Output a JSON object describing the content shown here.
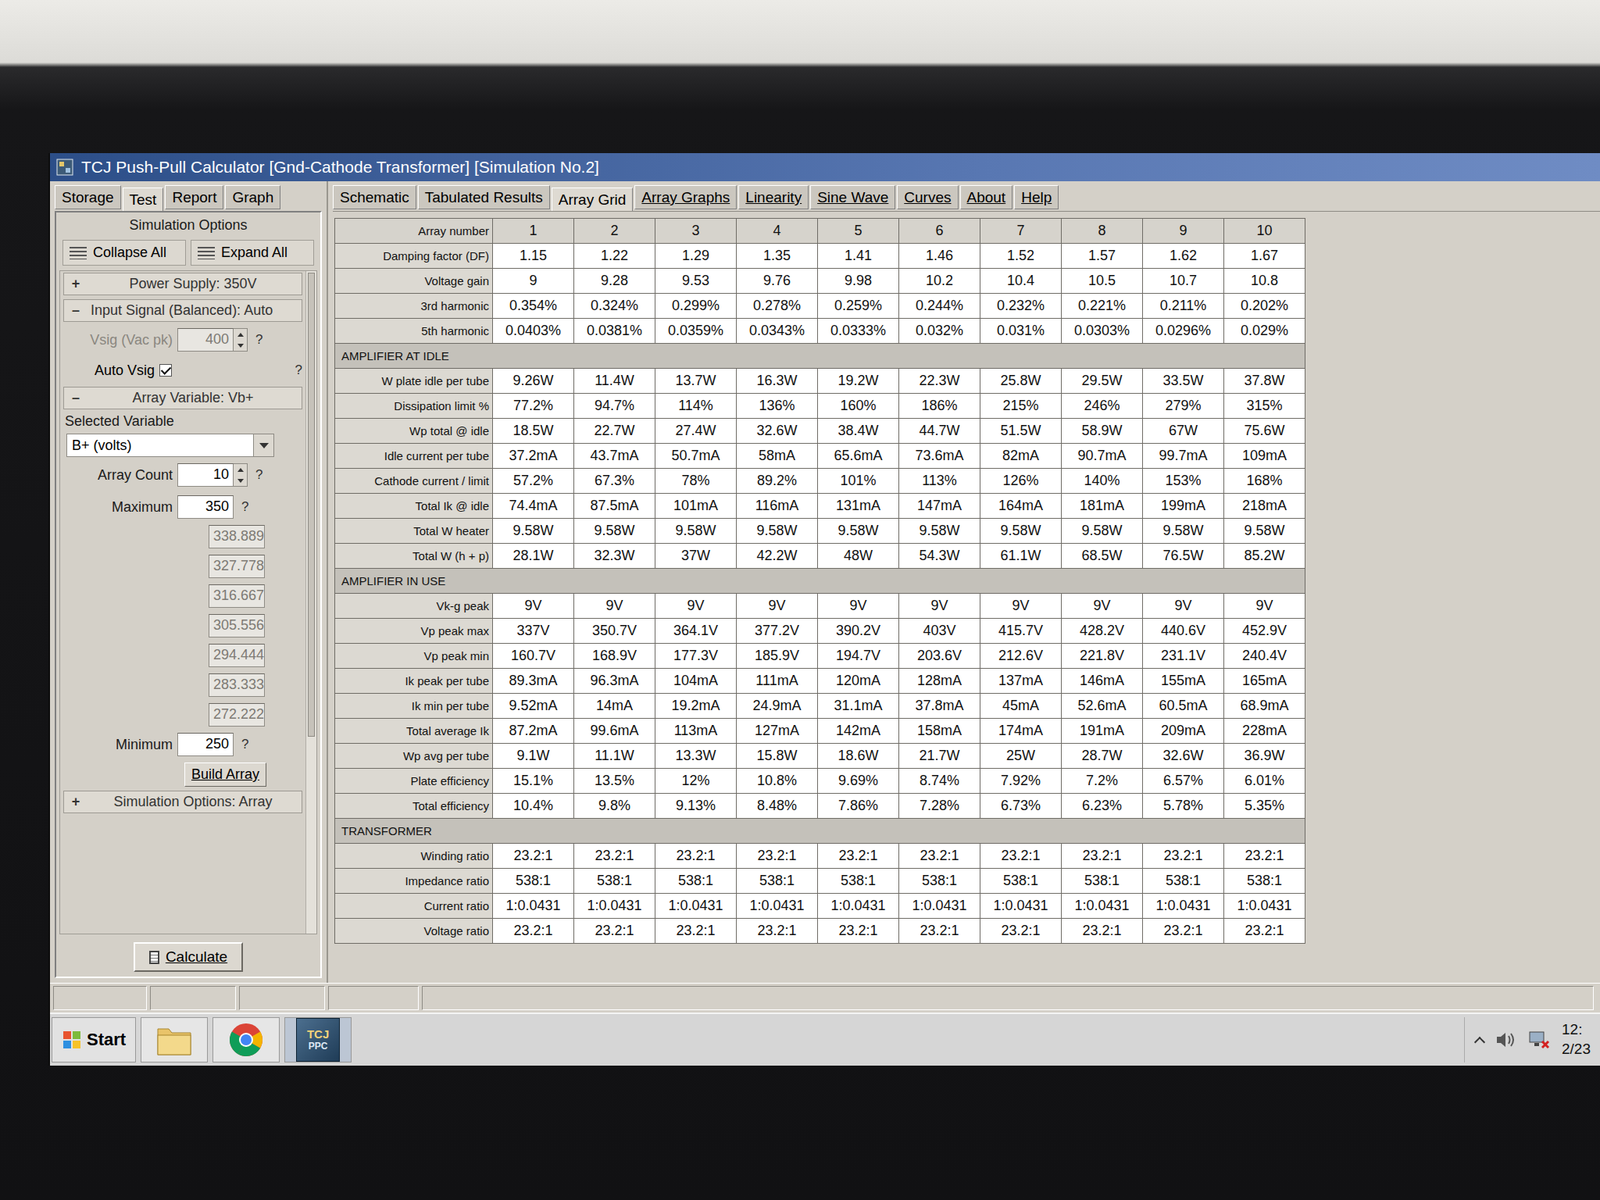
{
  "window": {
    "title": "TCJ Push-Pull Calculator [Gnd-Cathode Transformer] [Simulation No.2]"
  },
  "left_tabs": [
    {
      "label": "Storage",
      "selected": false
    },
    {
      "label": "Test",
      "selected": true
    },
    {
      "label": "Report",
      "selected": false
    },
    {
      "label": "Graph",
      "selected": false
    }
  ],
  "main_tabs": [
    {
      "label": "Schematic",
      "selected": false
    },
    {
      "label": "Tabulated Results",
      "selected": false
    },
    {
      "label": "Array Grid",
      "selected": true
    },
    {
      "label": "Array Graphs",
      "selected": false
    },
    {
      "label": "Linearity",
      "selected": false
    },
    {
      "label": "Sine Wave",
      "selected": false
    },
    {
      "label": "Curves",
      "selected": false
    },
    {
      "label": "About",
      "selected": false
    },
    {
      "label": "Help",
      "selected": false
    }
  ],
  "sidebar": {
    "header": "Simulation Options",
    "collapse_all": "Collapse All",
    "expand_all": "Expand All",
    "power_supply": {
      "toggle": "+",
      "label": "Power Supply: 350V",
      "expanded": false
    },
    "input_signal": {
      "toggle": "–",
      "label": "Input Signal (Balanced): Auto",
      "expanded": true
    },
    "vsig": {
      "label": "Vsig (Vac pk)",
      "value": "400",
      "disabled": true,
      "help": "?"
    },
    "auto_vsig": {
      "label": "Auto Vsig",
      "checked": true,
      "help": "?"
    },
    "array_variable": {
      "toggle": "–",
      "label": "Array Variable: Vb+",
      "expanded": true
    },
    "selected_variable": {
      "label": "Selected Variable",
      "value": "B+ (volts)"
    },
    "array_count": {
      "label": "Array Count",
      "value": "10",
      "help": "?"
    },
    "maximum": {
      "label": "Maximum",
      "value": "350",
      "help": "?"
    },
    "steps": [
      "338.889",
      "327.778",
      "316.667",
      "305.556",
      "294.444",
      "283.333",
      "272.222"
    ],
    "minimum": {
      "label": "Minimum",
      "value": "250",
      "help": "?"
    },
    "build_button": "Build Array",
    "sim_options": {
      "toggle": "+",
      "label": "Simulation Options: Array",
      "expanded": false
    },
    "calculate": "Calculate"
  },
  "table": {
    "columns": [
      "Array number",
      "1",
      "2",
      "3",
      "4",
      "5",
      "6",
      "7",
      "8",
      "9",
      "10"
    ],
    "rows": [
      {
        "kind": "data",
        "label": "Damping factor (DF)",
        "cells": [
          "1.15",
          "1.22",
          "1.29",
          "1.35",
          "1.41",
          "1.46",
          "1.52",
          "1.57",
          "1.62",
          "1.67"
        ]
      },
      {
        "kind": "data",
        "label": "Voltage gain",
        "cells": [
          "9",
          "9.28",
          "9.53",
          "9.76",
          "9.98",
          "10.2",
          "10.4",
          "10.5",
          "10.7",
          "10.8"
        ]
      },
      {
        "kind": "data",
        "label": "3rd harmonic",
        "cells": [
          "0.354%",
          "0.324%",
          "0.299%",
          "0.278%",
          "0.259%",
          "0.244%",
          "0.232%",
          "0.221%",
          "0.211%",
          "0.202%"
        ]
      },
      {
        "kind": "data",
        "label": "5th harmonic",
        "cells": [
          "0.0403%",
          "0.0381%",
          "0.0359%",
          "0.0343%",
          "0.0333%",
          "0.032%",
          "0.031%",
          "0.0303%",
          "0.0296%",
          "0.029%"
        ]
      },
      {
        "kind": "section",
        "label": "AMPLIFIER AT IDLE",
        "cells": []
      },
      {
        "kind": "data",
        "label": "W plate idle per tube",
        "cells": [
          "9.26W",
          "11.4W",
          "13.7W",
          "16.3W",
          "19.2W",
          "22.3W",
          "25.8W",
          "29.5W",
          "33.5W",
          "37.8W"
        ]
      },
      {
        "kind": "data",
        "label": "Dissipation limit %",
        "cells": [
          "77.2%",
          "94.7%",
          "114%",
          "136%",
          "160%",
          "186%",
          "215%",
          "246%",
          "279%",
          "315%"
        ]
      },
      {
        "kind": "data",
        "label": "Wp total @ idle",
        "cells": [
          "18.5W",
          "22.7W",
          "27.4W",
          "32.6W",
          "38.4W",
          "44.7W",
          "51.5W",
          "58.9W",
          "67W",
          "75.6W"
        ]
      },
      {
        "kind": "data",
        "label": "Idle current per tube",
        "cells": [
          "37.2mA",
          "43.7mA",
          "50.7mA",
          "58mA",
          "65.6mA",
          "73.6mA",
          "82mA",
          "90.7mA",
          "99.7mA",
          "109mA"
        ]
      },
      {
        "kind": "data",
        "label": "Cathode current / limit",
        "cells": [
          "57.2%",
          "67.3%",
          "78%",
          "89.2%",
          "101%",
          "113%",
          "126%",
          "140%",
          "153%",
          "168%"
        ]
      },
      {
        "kind": "data",
        "label": "Total Ik @ idle",
        "cells": [
          "74.4mA",
          "87.5mA",
          "101mA",
          "116mA",
          "131mA",
          "147mA",
          "164mA",
          "181mA",
          "199mA",
          "218mA"
        ]
      },
      {
        "kind": "data",
        "label": "Total W heater",
        "cells": [
          "9.58W",
          "9.58W",
          "9.58W",
          "9.58W",
          "9.58W",
          "9.58W",
          "9.58W",
          "9.58W",
          "9.58W",
          "9.58W"
        ]
      },
      {
        "kind": "data",
        "label": "Total W (h + p)",
        "cells": [
          "28.1W",
          "32.3W",
          "37W",
          "42.2W",
          "48W",
          "54.3W",
          "61.1W",
          "68.5W",
          "76.5W",
          "85.2W"
        ]
      },
      {
        "kind": "section",
        "label": "AMPLIFIER IN USE",
        "cells": []
      },
      {
        "kind": "data",
        "label": "Vk-g peak",
        "cells": [
          "9V",
          "9V",
          "9V",
          "9V",
          "9V",
          "9V",
          "9V",
          "9V",
          "9V",
          "9V"
        ]
      },
      {
        "kind": "data",
        "label": "Vp peak max",
        "cells": [
          "337V",
          "350.7V",
          "364.1V",
          "377.2V",
          "390.2V",
          "403V",
          "415.7V",
          "428.2V",
          "440.6V",
          "452.9V"
        ]
      },
      {
        "kind": "data",
        "label": "Vp peak min",
        "cells": [
          "160.7V",
          "168.9V",
          "177.3V",
          "185.9V",
          "194.7V",
          "203.6V",
          "212.6V",
          "221.8V",
          "231.1V",
          "240.4V"
        ]
      },
      {
        "kind": "data",
        "label": "Ik peak per tube",
        "cells": [
          "89.3mA",
          "96.3mA",
          "104mA",
          "111mA",
          "120mA",
          "128mA",
          "137mA",
          "146mA",
          "155mA",
          "165mA"
        ]
      },
      {
        "kind": "data",
        "label": "Ik min per tube",
        "cells": [
          "9.52mA",
          "14mA",
          "19.2mA",
          "24.9mA",
          "31.1mA",
          "37.8mA",
          "45mA",
          "52.6mA",
          "60.5mA",
          "68.9mA"
        ]
      },
      {
        "kind": "data",
        "label": "Total average Ik",
        "cells": [
          "87.2mA",
          "99.6mA",
          "113mA",
          "127mA",
          "142mA",
          "158mA",
          "174mA",
          "191mA",
          "209mA",
          "228mA"
        ]
      },
      {
        "kind": "data",
        "label": "Wp avg per tube",
        "cells": [
          "9.1W",
          "11.1W",
          "13.3W",
          "15.8W",
          "18.6W",
          "21.7W",
          "25W",
          "28.7W",
          "32.6W",
          "36.9W"
        ]
      },
      {
        "kind": "data",
        "label": "Plate efficiency",
        "cells": [
          "15.1%",
          "13.5%",
          "12%",
          "10.8%",
          "9.69%",
          "8.74%",
          "7.92%",
          "7.2%",
          "6.57%",
          "6.01%"
        ]
      },
      {
        "kind": "data",
        "label": "Total efficiency",
        "cells": [
          "10.4%",
          "9.8%",
          "9.13%",
          "8.48%",
          "7.86%",
          "7.28%",
          "6.73%",
          "6.23%",
          "5.78%",
          "5.35%"
        ]
      },
      {
        "kind": "section",
        "label": "TRANSFORMER",
        "cells": []
      },
      {
        "kind": "data",
        "label": "Winding ratio",
        "cells": [
          "23.2:1",
          "23.2:1",
          "23.2:1",
          "23.2:1",
          "23.2:1",
          "23.2:1",
          "23.2:1",
          "23.2:1",
          "23.2:1",
          "23.2:1"
        ]
      },
      {
        "kind": "data",
        "label": "Impedance ratio",
        "cells": [
          "538:1",
          "538:1",
          "538:1",
          "538:1",
          "538:1",
          "538:1",
          "538:1",
          "538:1",
          "538:1",
          "538:1"
        ]
      },
      {
        "kind": "data",
        "label": "Current ratio",
        "cells": [
          "1:0.0431",
          "1:0.0431",
          "1:0.0431",
          "1:0.0431",
          "1:0.0431",
          "1:0.0431",
          "1:0.0431",
          "1:0.0431",
          "1:0.0431",
          "1:0.0431"
        ]
      },
      {
        "kind": "data",
        "label": "Voltage ratio",
        "cells": [
          "23.2:1",
          "23.2:1",
          "23.2:1",
          "23.2:1",
          "23.2:1",
          "23.2:1",
          "23.2:1",
          "23.2:1",
          "23.2:1",
          "23.2:1"
        ]
      }
    ]
  },
  "taskbar": {
    "start": "Start",
    "app_badge": [
      "TCJ",
      "PPC"
    ],
    "clock": [
      "12:",
      "2/23"
    ]
  }
}
